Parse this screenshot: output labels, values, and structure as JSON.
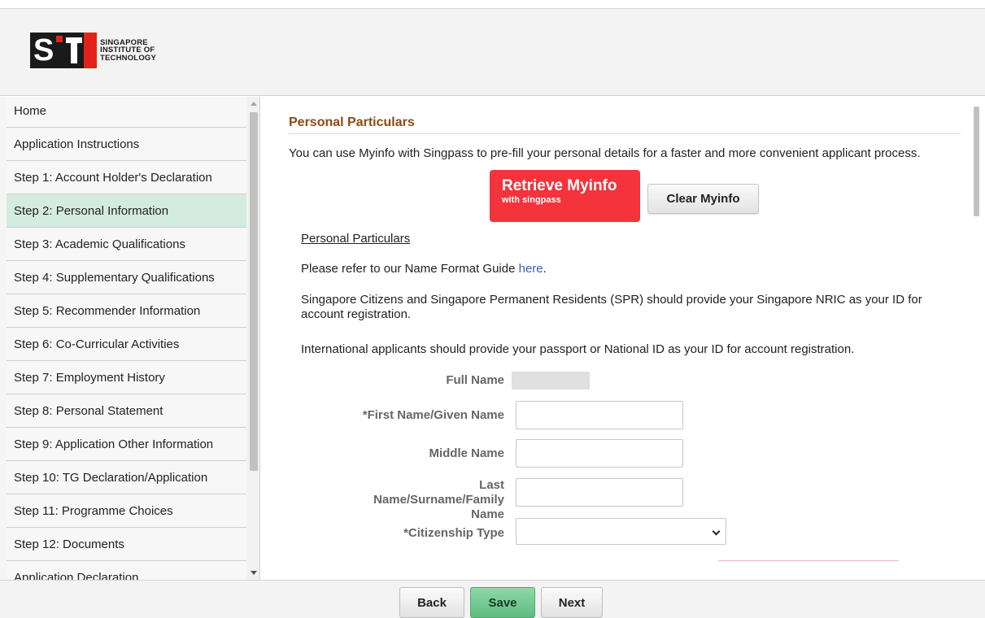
{
  "header": {
    "logo_lines": [
      "SINGAPORE",
      "INSTITUTE OF",
      "TECHNOLOGY"
    ]
  },
  "sidebar": {
    "items": [
      {
        "label": "Home"
      },
      {
        "label": "Application Instructions"
      },
      {
        "label": "Step 1: Account Holder's Declaration"
      },
      {
        "label": "Step 2: Personal Information",
        "active": true
      },
      {
        "label": "Step 3: Academic Qualifications"
      },
      {
        "label": "Step 4: Supplementary Qualifications"
      },
      {
        "label": "Step 5: Recommender Information"
      },
      {
        "label": "Step 6: Co-Curricular Activities"
      },
      {
        "label": "Step 7: Employment History"
      },
      {
        "label": "Step 8: Personal Statement"
      },
      {
        "label": "Step 9: Application Other Information"
      },
      {
        "label": "Step 10: TG Declaration/Application"
      },
      {
        "label": "Step 11: Programme Choices"
      },
      {
        "label": "Step 12: Documents"
      },
      {
        "label": "Application Declaration"
      }
    ]
  },
  "main": {
    "section_title": "Personal Particulars",
    "intro": "You can use Myinfo with Singpass to pre-fill your personal details for a faster and more convenient applicant process.",
    "myinfo_button": {
      "title": "Retrieve Myinfo",
      "subtitle": "with singpass"
    },
    "clear_button": "Clear Myinfo",
    "sub_heading": "Personal Particulars",
    "name_guide_text": "Please refer to our Name Format Guide ",
    "name_guide_link": "here",
    "name_guide_end": ".",
    "citizens_note": "Singapore Citizens and Singapore Permanent Residents (SPR) should provide your Singapore NRIC as your ID for account registration.",
    "international_note": "International applicants should provide your passport or National ID as your ID for account registration.",
    "form": {
      "full_name_label": "Full Name",
      "first_name_label": "*First Name/Given Name",
      "first_name_value": "",
      "middle_name_label": "Middle Name",
      "middle_name_value": "",
      "last_name_label": "Last Name/Surname/Family Name",
      "last_name_value": "",
      "citizenship_label": "*Citizenship Type",
      "citizenship_value": ""
    }
  },
  "footer": {
    "back": "Back",
    "save": "Save",
    "next": "Next"
  },
  "colors": {
    "section_title": "#8a4b16",
    "myinfo_red": "#f4333d",
    "active_nav": "#d4ecdf",
    "save_green": "#5ebd80",
    "link_blue": "#3a5fb0"
  }
}
